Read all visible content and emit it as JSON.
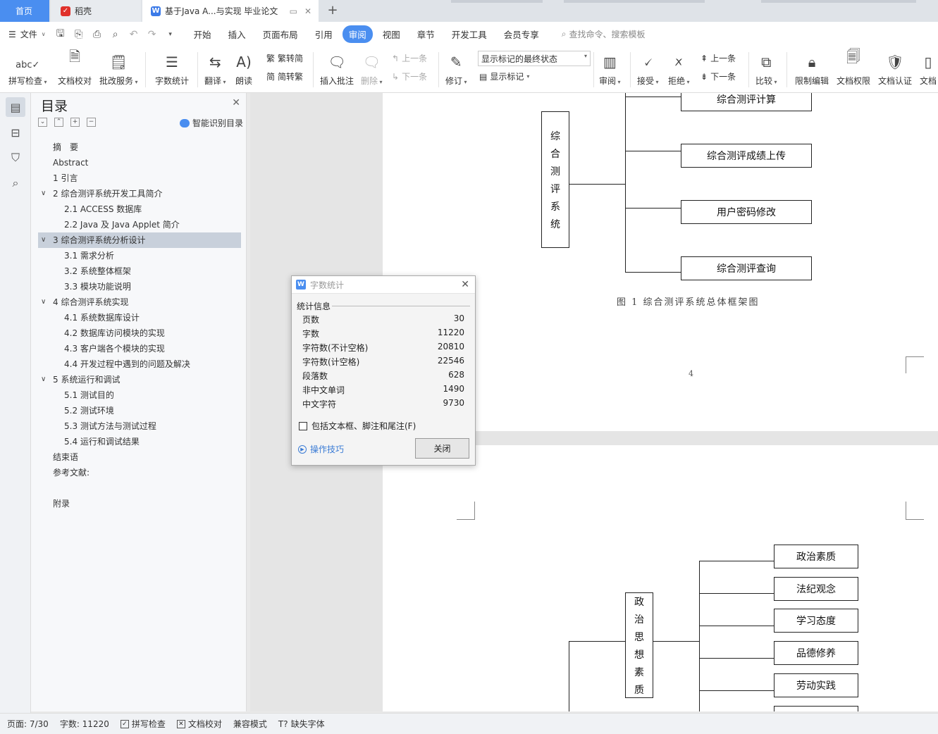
{
  "tabs": {
    "home": "首页",
    "daoke": "稻壳",
    "document": "基于Java A...与实现 毕业论文",
    "add": "+"
  },
  "menu": {
    "file": "文件",
    "items": [
      "开始",
      "插入",
      "页面布局",
      "引用",
      "审阅",
      "视图",
      "章节",
      "开发工具",
      "会员专享"
    ],
    "active": "审阅",
    "search": "查找命令、搜索模板"
  },
  "ribbon": {
    "spellcheck": "拼写检查",
    "proofread": "文档校对",
    "revise_service": "批改服务",
    "word_count": "字数统计",
    "translate": "翻译",
    "read_aloud": "朗读",
    "trad_simp": "繁转简",
    "simp_trad": "简转繁",
    "insert_comment": "插入批注",
    "delete": "删除",
    "prev": "上一条",
    "next": "下一条",
    "track": "修订",
    "markup_state": "显示标记的最终状态",
    "show_markup": "显示标记",
    "review": "审阅",
    "accept": "接受",
    "reject": "拒绝",
    "prev2": "上一条",
    "next2": "下一条",
    "compare": "比较",
    "restrict": "限制编辑",
    "permission": "文档权限",
    "certify": "文档认证",
    "last_partial": "文档"
  },
  "toc": {
    "title": "目录",
    "smart": "智能识别目录",
    "items": [
      {
        "text": "摘　要",
        "level": 1
      },
      {
        "text": "Abstract",
        "level": 1
      },
      {
        "text": "1  引言",
        "level": 1
      },
      {
        "text": "2  综合测评系统开发工具简介",
        "level": 1,
        "expanded": true
      },
      {
        "text": "2.1    ACCESS 数据库",
        "level": 2
      },
      {
        "text": "2.2 Java 及 Java Applet 简介",
        "level": 2
      },
      {
        "text": "3  综合测评系统分析设计",
        "level": 1,
        "expanded": true,
        "selected": true
      },
      {
        "text": "3.1 需求分析",
        "level": 2
      },
      {
        "text": "3.2 系统整体框架",
        "level": 2
      },
      {
        "text": "3.3 模块功能说明",
        "level": 2
      },
      {
        "text": "4  综合测评系统实现",
        "level": 1,
        "expanded": true
      },
      {
        "text": "4.1 系统数据库设计",
        "level": 2
      },
      {
        "text": "4.2 数据库访问模块的实现",
        "level": 2
      },
      {
        "text": "4.3 客户端各个模块的实现",
        "level": 2
      },
      {
        "text": "4.4 开发过程中遇到的问题及解决",
        "level": 2
      },
      {
        "text": "5  系统运行和调试",
        "level": 1,
        "expanded": true
      },
      {
        "text": "5.1 测试目的",
        "level": 2
      },
      {
        "text": "5.2 测试环境",
        "level": 2
      },
      {
        "text": "5.3 测试方法与测试过程",
        "level": 2
      },
      {
        "text": "5.4 运行和调试结果",
        "level": 2
      },
      {
        "text": "结束语",
        "level": 1
      },
      {
        "text": "参考文献:",
        "level": 1
      },
      {
        "text": "",
        "level": 1
      },
      {
        "text": "附录",
        "level": 1
      }
    ]
  },
  "doc": {
    "diagram1": {
      "root": [
        "综",
        "合",
        "测",
        "评",
        "系",
        "统"
      ],
      "branches": [
        "综合测评计算",
        "综合测评成绩上传",
        "用户密码修改",
        "综合测评查询"
      ],
      "caption": "图 1   综合测评系统总体框架图"
    },
    "page_number": "4",
    "diagram2": {
      "root": [
        "政",
        "治",
        "思",
        "想",
        "素",
        "质"
      ],
      "branches": [
        "政治素质",
        "法纪观念",
        "学习态度",
        "品德修养",
        "劳动实践"
      ]
    }
  },
  "dialog": {
    "title": "字数统计",
    "section": "统计信息",
    "stats": [
      {
        "label": "页数",
        "value": "30"
      },
      {
        "label": "字数",
        "value": "11220"
      },
      {
        "label": "字符数(不计空格)",
        "value": "20810"
      },
      {
        "label": "字符数(计空格)",
        "value": "22546"
      },
      {
        "label": "段落数",
        "value": "628"
      },
      {
        "label": "非中文单词",
        "value": "1490"
      },
      {
        "label": "中文字符",
        "value": "9730"
      }
    ],
    "include": "包括文本框、脚注和尾注(F)",
    "tips": "操作技巧",
    "close": "关闭"
  },
  "status": {
    "page": "页面: 7/30",
    "words": "字数: 11220",
    "spellcheck": "拼写检查",
    "proofread": "文档校对",
    "compat": "兼容模式",
    "missing_font": "缺失字体"
  },
  "colors": {
    "accent": "#4a8ef0",
    "link": "#3a7bd5"
  }
}
